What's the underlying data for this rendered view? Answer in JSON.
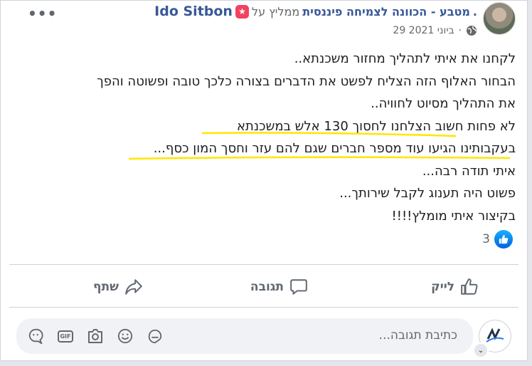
{
  "post": {
    "author": "Ido Sitbon",
    "recommends_text": "ממליץ על",
    "page_name": "מטבע - הכוונה לצמיחה פיננסית",
    "period": ".",
    "date": "29 ביוני 2021",
    "date_separator": "·",
    "body_lines": [
      "לקחנו את איתי לתהליך מחזור משכנתא..",
      "הבחור האלוף הזה הצליח לפשט את הדברים בצורה כלכך טובה ופשוטה והפך",
      "את התהליך מסיוט לחוויה..",
      "לא פחות חשוב הצלחנו לחסוך 130 אלש במשכנתא",
      "בעקבותינו הגיעו עוד מספר חברים שגם להם עזר וחסך המון כסף...",
      "איתי תודה רבה...",
      "פשוט היה תענוג לקבל שירותך...",
      "בקיצור איתי מומלץ!!!!"
    ],
    "highlight_color": "#ffe600"
  },
  "reactions": {
    "count": "3",
    "icon": "like-reaction-icon"
  },
  "actions": {
    "like": "לייק",
    "comment": "תגובה",
    "share": "שתף"
  },
  "comment_box": {
    "placeholder": "כתיבת תגובה...",
    "icons": [
      "smiley-icon",
      "sticker-icon",
      "camera-icon",
      "gif-icon",
      "avatar-sticker-icon"
    ],
    "gif_label": "GIF"
  },
  "colors": {
    "link": "#385898",
    "like_blue": "#1877f2",
    "badge": "#f3425f",
    "text": "#1c1e21",
    "muted": "#65676b"
  }
}
